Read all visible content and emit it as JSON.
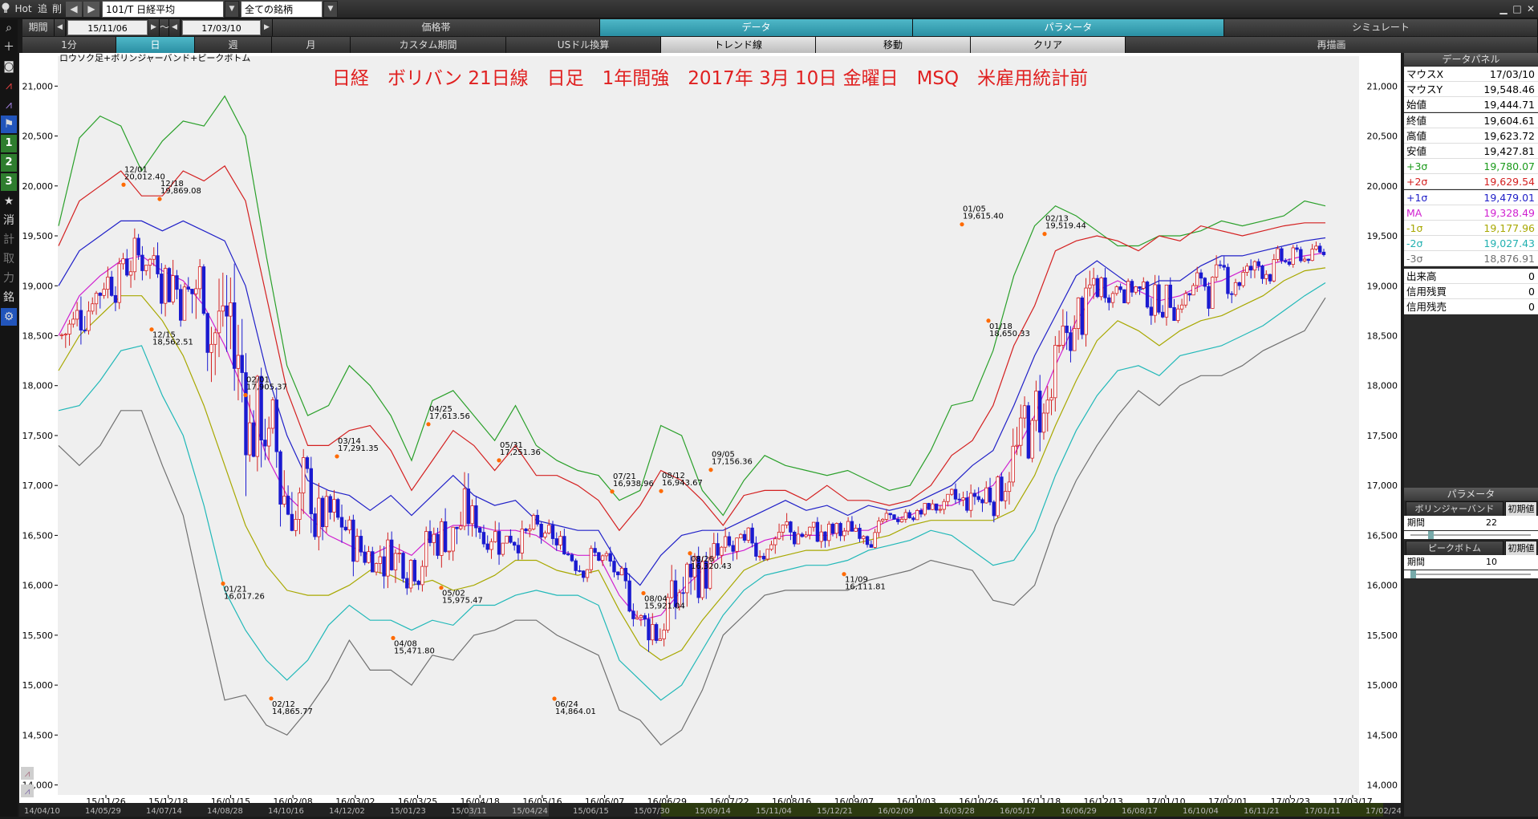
{
  "topbar": {
    "hot": "Hot",
    "back": "追",
    "del": "削",
    "symbol": "101/T 日経平均",
    "filter": "全ての銘柄"
  },
  "row2": {
    "period_label": "期間",
    "from": "15/11/06",
    "tilde": "～",
    "to": "17/03/10",
    "tabs": [
      "価格帯",
      "データ",
      "パラメータ",
      "シミュレート"
    ]
  },
  "row3": {
    "tabs": [
      "1分",
      "日",
      "週",
      "月",
      "カスタム期間",
      "USドル換算",
      "トレンド線",
      "移動",
      "クリア",
      "再描画"
    ]
  },
  "chart": {
    "caption": "ロウソク足+ボリンジャーバンド+ピークボトム",
    "title": "日経　ボリバン 21日線　日足　1年間強　2017年 3月 10日 金曜日　MSQ　米雇用統計前"
  },
  "chart_data": {
    "type": "candlestick",
    "y_ticks": [
      "21,000",
      "20,500",
      "20,000",
      "19,500",
      "19,000",
      "18,500",
      "18,000",
      "17,500",
      "17,000",
      "16,500",
      "16,000",
      "15,500",
      "15,000",
      "14,500",
      "14,000"
    ],
    "ylim": [
      13900,
      21300
    ],
    "x_ticks": [
      "15/11/26",
      "15/12/18",
      "16/01/15",
      "16/02/08",
      "16/03/02",
      "16/03/25",
      "16/04/18",
      "16/05/16",
      "16/06/07",
      "16/06/29",
      "16/07/22",
      "16/08/16",
      "16/09/07",
      "16/10/03",
      "16/10/26",
      "16/11/18",
      "16/12/13",
      "17/01/10",
      "17/02/01",
      "17/02/23",
      "17/03/17"
    ],
    "series": [
      {
        "name": "+3σ",
        "color": "#2aa02a",
        "values": [
          19600,
          20480,
          20700,
          20600,
          20150,
          20450,
          20650,
          20600,
          20900,
          20500,
          19300,
          18200,
          17700,
          17800,
          18200,
          18000,
          17700,
          17250,
          17850,
          17950,
          17700,
          17450,
          17800,
          17400,
          17250,
          17150,
          17100,
          16850,
          16950,
          17600,
          17500,
          16950,
          16700,
          17050,
          17300,
          17200,
          17150,
          17100,
          17150,
          17050,
          16950,
          17000,
          17350,
          17800,
          17850,
          18350,
          19100,
          19600,
          19800,
          19700,
          19550,
          19400,
          19400,
          19500,
          19500,
          19550,
          19650,
          19600,
          19650,
          19700,
          19850,
          19800
        ]
      },
      {
        "name": "+2σ",
        "color": "#d42020",
        "values": [
          19400,
          19850,
          20000,
          20150,
          19900,
          19900,
          20150,
          20050,
          20200,
          19850,
          18900,
          17950,
          17400,
          17400,
          17550,
          17600,
          17350,
          16950,
          17250,
          17550,
          17400,
          17150,
          17400,
          17100,
          17100,
          17000,
          16850,
          16550,
          16800,
          17150,
          17050,
          16850,
          16600,
          16900,
          16950,
          16950,
          16850,
          17000,
          16850,
          16850,
          16800,
          16850,
          17000,
          17300,
          17450,
          17800,
          18400,
          18800,
          19350,
          19450,
          19500,
          19450,
          19350,
          19500,
          19450,
          19600,
          19550,
          19500,
          19550,
          19600,
          19630,
          19630
        ]
      },
      {
        "name": "+1σ",
        "color": "#2020c8",
        "values": [
          19000,
          19350,
          19500,
          19650,
          19650,
          19550,
          19650,
          19550,
          19450,
          19000,
          18150,
          17500,
          17050,
          16950,
          16900,
          16750,
          16900,
          16700,
          16900,
          17100,
          16900,
          16800,
          16850,
          16650,
          16600,
          16550,
          16550,
          16200,
          16000,
          16300,
          16500,
          16550,
          16550,
          16650,
          16750,
          16850,
          16750,
          16800,
          16700,
          16800,
          16750,
          16800,
          16900,
          17000,
          17200,
          17350,
          17800,
          18300,
          18700,
          19100,
          19250,
          19100,
          18950,
          19050,
          19050,
          19200,
          19300,
          19300,
          19350,
          19400,
          19450,
          19480
        ]
      },
      {
        "name": "MA",
        "color": "#d020d0",
        "values": [
          18500,
          18900,
          19100,
          19250,
          19300,
          19150,
          19050,
          18800,
          18400,
          17900,
          17300,
          16900,
          16700,
          16500,
          16400,
          16300,
          16400,
          16300,
          16500,
          16600,
          16600,
          16550,
          16550,
          16500,
          16350,
          16300,
          16300,
          15900,
          15650,
          15700,
          15950,
          16150,
          16300,
          16350,
          16450,
          16500,
          16500,
          16500,
          16550,
          16550,
          16650,
          16700,
          16800,
          16800,
          16900,
          17000,
          17300,
          17700,
          18200,
          18650,
          18950,
          19050,
          18950,
          18850,
          18900,
          19000,
          19050,
          19150,
          19200,
          19250,
          19300,
          19330
        ]
      },
      {
        "name": "-1σ",
        "color": "#a8a800",
        "values": [
          18150,
          18500,
          18700,
          18900,
          18900,
          18650,
          18300,
          17800,
          17200,
          16600,
          16200,
          15950,
          15900,
          15900,
          16000,
          16150,
          16100,
          16000,
          16050,
          15950,
          16000,
          16100,
          16250,
          16250,
          16150,
          16100,
          16150,
          15750,
          15400,
          15250,
          15350,
          15650,
          15900,
          16150,
          16250,
          16300,
          16350,
          16350,
          16400,
          16450,
          16500,
          16600,
          16650,
          16650,
          16650,
          16650,
          16750,
          17100,
          17600,
          18050,
          18450,
          18650,
          18550,
          18400,
          18550,
          18650,
          18700,
          18800,
          18900,
          19050,
          19150,
          19180
        ]
      },
      {
        "name": "-2σ",
        "color": "#20b8b8",
        "values": [
          17750,
          17800,
          18050,
          18350,
          18400,
          17900,
          17500,
          16800,
          15950,
          15550,
          15250,
          15050,
          15250,
          15600,
          15800,
          15650,
          15650,
          15550,
          15650,
          15600,
          15800,
          15800,
          15900,
          15950,
          15900,
          15900,
          15800,
          15250,
          15050,
          14850,
          15000,
          15350,
          15700,
          15950,
          16100,
          16150,
          16200,
          16200,
          16250,
          16350,
          16400,
          16450,
          16550,
          16500,
          16350,
          16200,
          16250,
          16550,
          17100,
          17550,
          17900,
          18150,
          18200,
          18100,
          18300,
          18350,
          18400,
          18500,
          18600,
          18750,
          18900,
          19030
        ]
      },
      {
        "name": "-3σ",
        "color": "#707070",
        "values": [
          17400,
          17200,
          17400,
          17750,
          17750,
          17200,
          16700,
          15750,
          14850,
          14900,
          14600,
          14500,
          14750,
          15050,
          15450,
          15150,
          15150,
          15000,
          15300,
          15250,
          15500,
          15550,
          15650,
          15650,
          15500,
          15400,
          15300,
          14750,
          14650,
          14400,
          14550,
          14950,
          15500,
          15700,
          15900,
          15950,
          15950,
          15950,
          15950,
          16050,
          16100,
          16150,
          16250,
          16200,
          16150,
          15850,
          15800,
          16000,
          16600,
          17050,
          17400,
          17700,
          17950,
          17800,
          18000,
          18100,
          18100,
          18200,
          18350,
          18450,
          18550,
          18880
        ]
      }
    ],
    "peaks": [
      {
        "label": "12/01",
        "value": "20,012.40"
      },
      {
        "label": "12/18",
        "value": "19,869.08"
      },
      {
        "label": "12/15",
        "value": "18,562.51"
      },
      {
        "label": "02/01",
        "value": "17,905.37"
      },
      {
        "label": "01/21",
        "value": "16,017.26"
      },
      {
        "label": "02/12",
        "value": "14,865.77"
      },
      {
        "label": "03/14",
        "value": "17,291.35"
      },
      {
        "label": "04/08",
        "value": "15,471.80"
      },
      {
        "label": "04/25",
        "value": "17,613.56"
      },
      {
        "label": "05/02",
        "value": "15,975.47"
      },
      {
        "label": "05/31",
        "value": "17,251.36"
      },
      {
        "label": "06/24",
        "value": "14,864.01"
      },
      {
        "label": "07/21",
        "value": "16,938.96"
      },
      {
        "label": "08/04",
        "value": "15,921.04"
      },
      {
        "label": "08/12",
        "value": "16,943.67"
      },
      {
        "label": "08/26",
        "value": "16,320.43"
      },
      {
        "label": "09/05",
        "value": "17,156.36"
      },
      {
        "label": "11/09",
        "value": "16,111.81"
      },
      {
        "label": "01/05",
        "value": "19,615.40"
      },
      {
        "label": "01/18",
        "value": "18,650.33"
      },
      {
        "label": "02/13",
        "value": "19,519.44"
      }
    ]
  },
  "data_panel": {
    "title": "データパネル",
    "rows": [
      {
        "label": "マウスX",
        "value": "17/03/10",
        "color": "#000000"
      },
      {
        "label": "マウスY",
        "value": "19,548.46",
        "color": "#000000"
      },
      {
        "label": "始値",
        "value": "19,444.71",
        "color": "#000000"
      },
      {
        "label": "終値",
        "value": "19,604.61",
        "color": "#000000"
      },
      {
        "label": "高値",
        "value": "19,623.72",
        "color": "#000000"
      },
      {
        "label": "安値",
        "value": "19,427.81",
        "color": "#000000"
      },
      {
        "label": "+3σ",
        "value": "19,780.07",
        "color": "#1a9a1a"
      },
      {
        "label": "+2σ",
        "value": "19,629.54",
        "color": "#d42020"
      },
      {
        "label": "+1σ",
        "value": "19,479.01",
        "color": "#2020c8"
      },
      {
        "label": "MA",
        "value": "19,328.49",
        "color": "#d020d0"
      },
      {
        "label": "-1σ",
        "value": "19,177.96",
        "color": "#a8a800"
      },
      {
        "label": "-2σ",
        "value": "19,027.43",
        "color": "#20b0b0"
      },
      {
        "label": "-3σ",
        "value": "18,876.91",
        "color": "#707070"
      },
      {
        "label": "出来高",
        "value": "0",
        "color": "#000000"
      },
      {
        "label": "信用残買",
        "value": "0",
        "color": "#000000"
      },
      {
        "label": "信用残売",
        "value": "0",
        "color": "#000000"
      }
    ]
  },
  "param_panel": {
    "title": "パラメータ",
    "bb_label": "ボリンジャーバンド",
    "init_label": "初期値",
    "period_label": "期間",
    "bb_period": "22",
    "pb_label": "ピークボトム",
    "pb_period": "10"
  },
  "bottom_dates": [
    "14/04/10",
    "14/05/29",
    "14/07/14",
    "14/08/28",
    "14/10/16",
    "14/12/02",
    "15/01/23",
    "15/03/11",
    "15/04/24",
    "15/06/15",
    "15/07/30",
    "15/09/14",
    "15/11/04",
    "15/12/21",
    "16/02/09",
    "16/03/28",
    "16/05/17",
    "16/06/29",
    "16/08/17",
    "16/10/04",
    "16/11/21",
    "17/01/11",
    "17/02/24"
  ]
}
